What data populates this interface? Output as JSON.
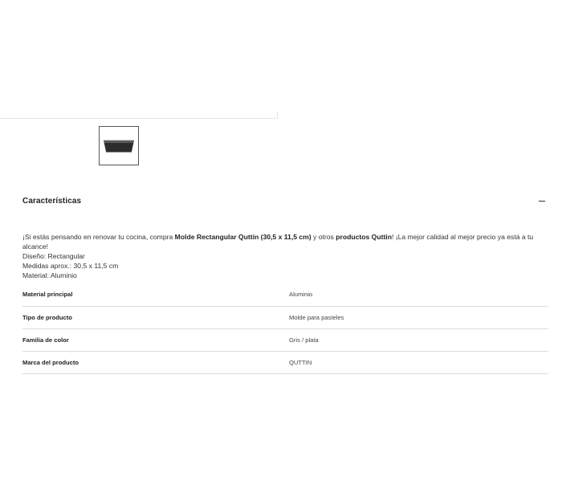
{
  "gallery": {
    "thumbnails": [
      {
        "alt": "Molde Rectangular Quttin",
        "icon": "loaf-pan-thumbnail"
      }
    ]
  },
  "characteristics": {
    "title": "Características",
    "toggle_icon": "minus-icon",
    "description": {
      "intro_1": "¡Si estás pensando en renovar tu cocina, compra ",
      "product_name": "Molde Rectangular Quttin (30,5 x 11,5 cm)",
      "intro_2": " y otros ",
      "brand_link": "productos Quttin",
      "intro_3": "! ¡La mejor calidad al mejor precio ya está a tu alcance!",
      "design": "Diseño: Rectangular",
      "dimensions": "Medidas aprox.: 30,5 x 11,5 cm",
      "material": "Material: Aluminio"
    },
    "specs": [
      {
        "label": "Material principal",
        "value": "Aluminio"
      },
      {
        "label": "Tipo de producto",
        "value": "Molde para pasteles"
      },
      {
        "label": "Familia de color",
        "value": "Gris / plata"
      },
      {
        "label": "Marca del producto",
        "value": "QUTTIN"
      }
    ]
  }
}
